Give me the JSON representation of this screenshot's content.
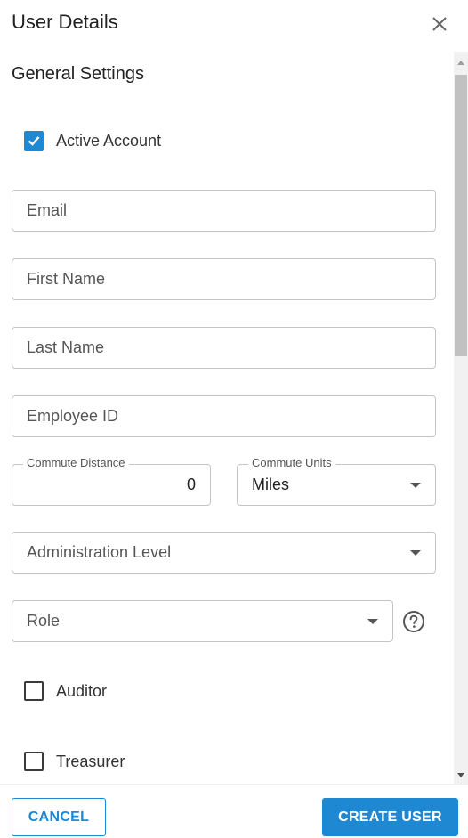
{
  "header": {
    "title": "User Details",
    "close_icon": "close-icon"
  },
  "section": {
    "title": "General Settings"
  },
  "active_account": {
    "label": "Active Account",
    "checked": true
  },
  "fields": {
    "email": {
      "placeholder": "Email",
      "value": ""
    },
    "first_name": {
      "placeholder": "First Name",
      "value": ""
    },
    "last_name": {
      "placeholder": "Last Name",
      "value": ""
    },
    "employee_id": {
      "placeholder": "Employee ID",
      "value": ""
    },
    "commute_distance": {
      "label": "Commute Distance",
      "value": "0"
    },
    "commute_units": {
      "label": "Commute Units",
      "value": "Miles"
    },
    "administration_level": {
      "placeholder": "Administration Level"
    },
    "role": {
      "placeholder": "Role",
      "help_icon": "help-circle-icon"
    }
  },
  "roles": [
    {
      "label": "Auditor",
      "checked": false
    },
    {
      "label": "Treasurer",
      "checked": false
    }
  ],
  "footer": {
    "cancel_label": "CANCEL",
    "create_label": "CREATE USER"
  },
  "colors": {
    "accent": "#1e88d2",
    "border": "#c4c4c4"
  }
}
